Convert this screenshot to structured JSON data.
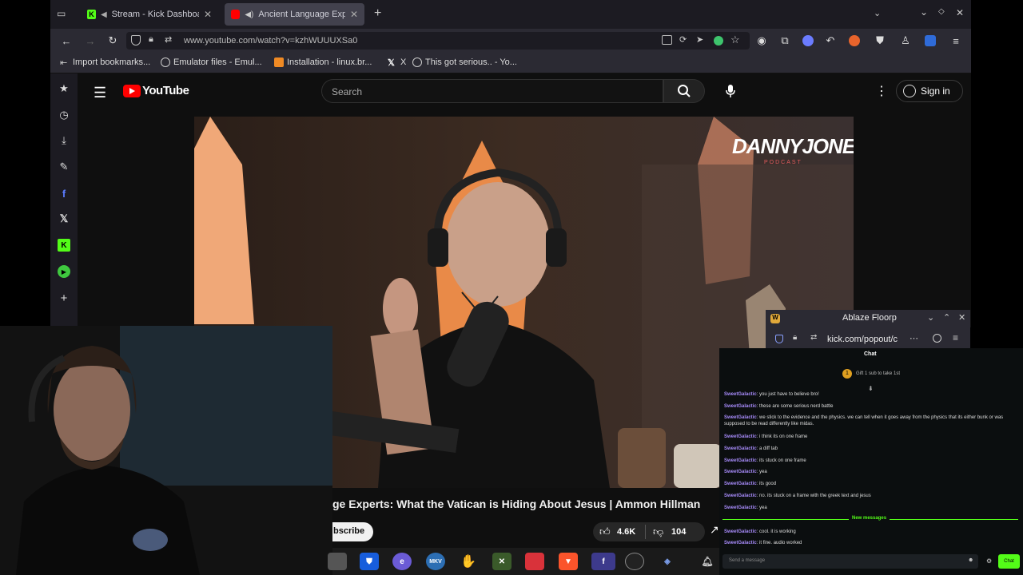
{
  "tabs": [
    {
      "title": "Stream - Kick Dashboard",
      "active": false
    },
    {
      "title": "Ancient Language Experts",
      "active": true
    }
  ],
  "url": "www.youtube.com/watch?v=kzhWUUUXSa0",
  "bookmarks": [
    "Import bookmarks...",
    "Emulator files - Emul...",
    "Installation - linux.br...",
    "X",
    "This got serious.. - Yo..."
  ],
  "youtube": {
    "logo_text": "YouTube",
    "search_placeholder": "Search",
    "sign_in": "Sign in",
    "video_title": "ge Experts: What the Vatican is Hiding About Jesus | Ammon Hillman",
    "subscribe": "bscribe",
    "likes": "4.6K",
    "dislikes": "104",
    "watermark": "DANNYJONES",
    "watermark_sub": "PODCAST"
  },
  "kick_popup": {
    "title": "Ablaze Floorp",
    "url": "kick.com/popout/c"
  },
  "chat": {
    "header": "Chat",
    "gift_text": "Gift 1 sub to take 1st",
    "messages": [
      {
        "user": "SweetGalactic",
        "text": ": you just have to believe bro!"
      },
      {
        "user": "SweetGalactic",
        "text": ": these are some serious nerd battle"
      },
      {
        "user": "SweetGalactic",
        "text": ": we stick to the evidence and the physics. we can tell when it goes away from the physics that its either bunk or was supposed to be read differently like midas."
      },
      {
        "user": "SweetGalactic",
        "text": ": i think its on one frame"
      },
      {
        "user": "SweetGalactic",
        "text": ": a diff tab"
      },
      {
        "user": "SweetGalactic",
        "text": ": its stuck on one frame"
      },
      {
        "user": "SweetGalactic",
        "text": ": yea"
      },
      {
        "user": "SweetGalactic",
        "text": ": its good"
      },
      {
        "user": "SweetGalactic",
        "text": ": no. its stuck on a frame with the greek text and jesus"
      },
      {
        "user": "SweetGalactic",
        "text": ": yea"
      }
    ],
    "new_messages_label": "New messages",
    "new_messages": [
      {
        "user": "SweetGalactic",
        "text": ": cool. it is working"
      },
      {
        "user": "SweetGalactic",
        "text": ": it fine. audio worked"
      }
    ],
    "input_placeholder": "Send a message",
    "send_label": "Chat"
  },
  "taskbar_items": [
    "app-icon",
    "bitwarden-icon",
    "edge-icon",
    "mkv-icon",
    "hand-icon",
    "tool-icon",
    "note-icon",
    "brave-icon",
    "floorp-icon",
    "obs-icon",
    "stack-icon"
  ],
  "colors": {
    "kick_green": "#53fc18",
    "youtube_red": "#ff0000",
    "chat_user": "#a78bfa"
  }
}
